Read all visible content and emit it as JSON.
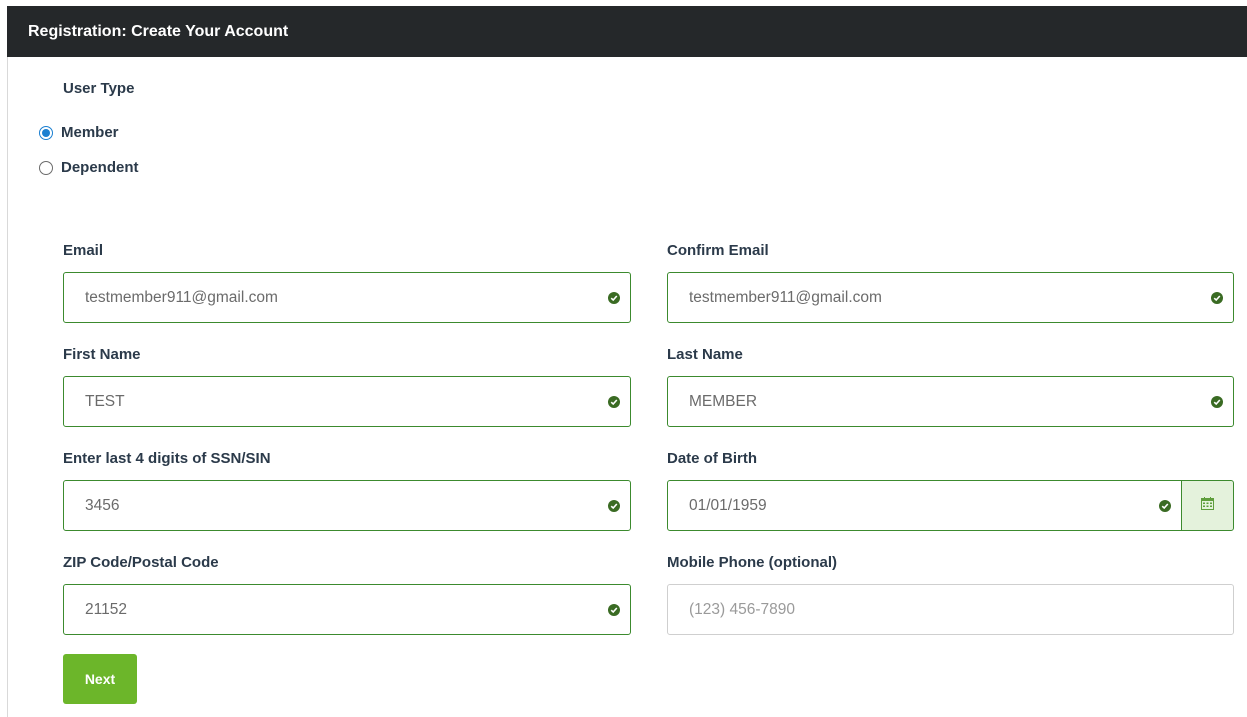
{
  "header": {
    "title": "Registration: Create Your Account"
  },
  "user_type": {
    "label": "User Type",
    "options": [
      {
        "label": "Member",
        "checked": true
      },
      {
        "label": "Dependent",
        "checked": false
      }
    ]
  },
  "form": {
    "email": {
      "label": "Email",
      "value": "testmember911@gmail.com",
      "valid": true
    },
    "confirm_email": {
      "label": "Confirm Email",
      "value": "testmember911@gmail.com",
      "valid": true
    },
    "first_name": {
      "label": "First Name",
      "value": "TEST",
      "valid": true
    },
    "last_name": {
      "label": "Last Name",
      "value": "MEMBER",
      "valid": true
    },
    "ssn": {
      "label": "Enter last 4 digits of SSN/SIN",
      "value": "3456",
      "valid": true
    },
    "dob": {
      "label": "Date of Birth",
      "value": "01/01/1959",
      "valid": true
    },
    "zip": {
      "label": "ZIP Code/Postal Code",
      "value": "21152",
      "valid": true
    },
    "mobile": {
      "label": "Mobile Phone (optional)",
      "value": "",
      "placeholder": "(123) 456-7890"
    }
  },
  "actions": {
    "next_label": "Next"
  },
  "colors": {
    "header_bg": "#25282a",
    "valid_border": "#3c8a2e",
    "valid_icon": "#3a6b23",
    "radio_accent": "#1a7fd1",
    "next_button": "#6cb62a",
    "calendar_addon_bg": "#e4f2dc"
  },
  "icons": {
    "valid": "check-circle-icon",
    "calendar": "calendar-icon"
  }
}
